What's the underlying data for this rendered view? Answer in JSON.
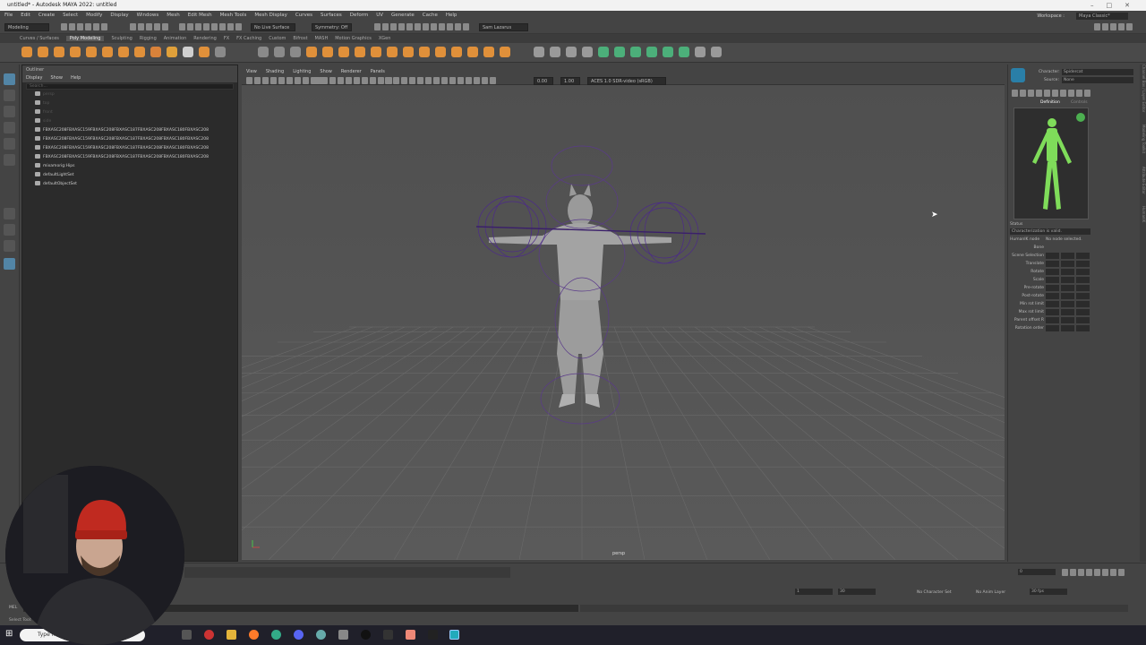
{
  "window": {
    "title": "untitled* - Autodesk MAYA 2022: untitled"
  },
  "menubar": {
    "items": [
      "File",
      "Edit",
      "Create",
      "Select",
      "Modify",
      "Display",
      "Windows",
      "Mesh",
      "Edit Mesh",
      "Mesh Tools",
      "Mesh Display",
      "Curves",
      "Surfaces",
      "Deform",
      "UV",
      "Generate",
      "Cache",
      "Help"
    ],
    "workspace_label": "Workspace :",
    "workspace_value": "Maya Classic*"
  },
  "statusline": {
    "mode": "Modeling",
    "live_surface": "No Live Surface",
    "symmetry": "Symmetry: Off",
    "user": "Sam Lazarus"
  },
  "shelf_tabs": {
    "items": [
      "Curves / Surfaces",
      "Poly Modeling",
      "Sculpting",
      "Rigging",
      "Animation",
      "Rendering",
      "FX",
      "FX Caching",
      "Custom",
      "Bifrost",
      "MASH",
      "Motion Graphics",
      "XGen"
    ],
    "active": 1
  },
  "outliner": {
    "title": "Outliner",
    "menu": [
      "Display",
      "Show",
      "Help"
    ],
    "search_placeholder": "Search...",
    "rows": [
      "persp",
      "top",
      "front",
      "side",
      "FBXASC208FBXASC159FBXASC208FBXASC187FBXASC208FBXASC180FBXASC208",
      "FBXASC208FBXASC159FBXASC208FBXASC187FBXASC208FBXASC180FBXASC208",
      "FBXASC208FBXASC159FBXASC208FBXASC187FBXASC208FBXASC180FBXASC208",
      "FBXASC208FBXASC159FBXASC208FBXASC187FBXASC208FBXASC180FBXASC208",
      "mixamorig:Hips",
      "defaultLightSet",
      "defaultObjectSet"
    ]
  },
  "viewport": {
    "menu": [
      "View",
      "Shading",
      "Lighting",
      "Show",
      "Renderer",
      "Panels"
    ],
    "exposure": "0.00",
    "gamma": "1.00",
    "colorspace": "ACES 1.0 SDR-video (sRGB)",
    "camera_label": "persp"
  },
  "humanik": {
    "character_label": "Character:",
    "character_value": "Spidercat",
    "source_label": "Source:",
    "source_value": "None",
    "tab_definition": "Definition",
    "tab_controls": "Controls",
    "status_label": "Status",
    "status_value": "Characterization is valid.",
    "node_label": "HumanIK node",
    "node_value": "No node selected.",
    "props": [
      "Bone",
      "Scene Selection",
      "Translate",
      "Rotate",
      "Scale",
      "Pre-rotate",
      "Post-rotate",
      "Min rot limit",
      "Max rot limit",
      "Parent offset R",
      "Rotation order"
    ]
  },
  "side_tabs": [
    "Channel Box / Layer Editor",
    "Modeling Toolkit",
    "Attribute Editor",
    "HumanIK"
  ],
  "timeline": {
    "current_frame": "0",
    "range_start": "1",
    "range_end": "30",
    "no_char": "No Character Set",
    "no_anim": "No Anim Layer",
    "fps": "30 fps"
  },
  "mel": {
    "label": "MEL"
  },
  "helpline": {
    "text": "Select Tool: select an object"
  },
  "taskbar": {
    "search": "Type here to search"
  }
}
